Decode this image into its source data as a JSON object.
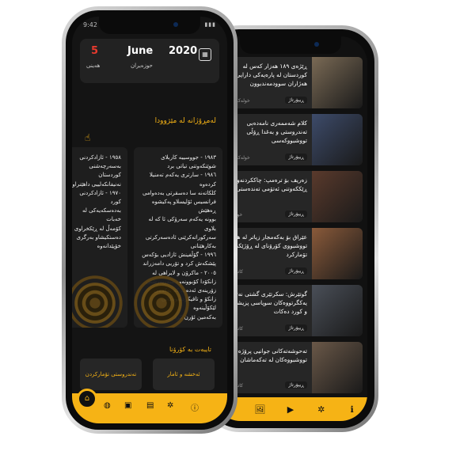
{
  "colors": {
    "accent": "#f6b315",
    "day_red": "#e83a2e",
    "background": "#141414",
    "card": "#222222"
  },
  "back_phone": {
    "news": [
      {
        "title": "ڕێژەی ١٨٩ هەزار کەس لە کوردستان لە پارەیەکی دارایی هەژاران سوودمەندبوون",
        "category": "ڕیپۆرتاژ",
        "meta": "16 خولەک لە",
        "thumb": "#7a6a55"
      },
      {
        "title": "کلام شەممەری نامەدەبی تەندروستی و بەغدا ڕۆڵی تووشبووکەسی",
        "category": "ڕیپۆرتاژ",
        "meta": "34 خولەک لە",
        "thumb": "#3d4b6a"
      },
      {
        "title": "زەریف بۆ ترەمپ: چاککردنەوەی ڕێککەوتنی ئەتۆمی تەندەستی",
        "category": "ڕیپۆرتاژ",
        "meta": "خولەک لە",
        "thumb": "#5a3a2c"
      },
      {
        "title": "عێراق بۆ بەکەمجار زیاتر لە هەزار تووشبووی کۆرۆنای لە ڕۆژێکدا تۆمارکرد",
        "category": "ڕیپۆرتاژ",
        "meta": "کاتژمێر لە",
        "thumb": "#8a5a3a"
      },
      {
        "title": "گوتێرش: سکرتێری گشتی نەتەوە یەکگرتووەکان سوپاسی پزیشکان و کورد دەکات",
        "category": "ڕیپۆرتاژ",
        "meta": "کاتژمێر لە",
        "thumb": "#4a4f58"
      },
      {
        "title": "تەحوشەتەکانی جوانیی پرۆژەی تووشبووەکان لە تەکەماشان",
        "category": "ڕیپۆرتاژ",
        "meta": "کاتژمێر لە",
        "thumb": "#6a5848"
      }
    ],
    "nav": [
      {
        "icon": "📍",
        "name": "location-icon"
      },
      {
        "icon": "🖼",
        "name": "image-icon"
      },
      {
        "icon": "▶",
        "name": "video-icon"
      },
      {
        "icon": "✲",
        "name": "star-icon"
      },
      {
        "icon": "ℹ",
        "name": "info-icon"
      }
    ]
  },
  "front_phone": {
    "status_time": "9:42",
    "date": {
      "day": "5",
      "day_name": "هەینی",
      "month": "June",
      "month_ku": "حوزەیران",
      "year": "2020"
    },
    "history_title": "لەمڕۆژانە لە مێژوودا",
    "history_cards": [
      {
        "text": "١٩٨٣ - جووسییە کاربلای\nشوێنکەوتنی تیاتی برد\n١٩٨٦ - سارتری یەکەم تەمنیلا کردەوە\nکلکاتەنه سا دەسقرتی بەدەوامی\nفرانسیس ئۆلیسلاو پەکیشوە ڕەهێش\nبوونە یەکەم سەرۆکی ئا کە لە بلاوی\nسەرکوراتەکرێنی ئادەسەرکرتی بەکارهێنانی\n١٩٩٦ - گۆڵفینش ئازادیی بۆکەس\nپێشکەش کرد و تۆریی دامەزراند\n٢٠٠٥ - ماکرۆن و لایراهی لە\nزانکۆدا کۆبوونەوە سەرپەرشتی\nزۆرینەی ئەدەب کە یەکەمی\nزانکۆ و تاقیکردنەوەکانی لێکۆڵینەوە\nبەکەمین ئۆرن کرد"
      },
      {
        "text": "١٩٥٨ - ئازادکردنی\nبەسەرچەشنی کوردستان\nنەنیفانکەلییی داهێنراو\n١٩٧٠ - ئازادکردنی کورد\nبەدەسکەیەکی لە خەبات\nکۆمەڵ لە ڕێکخراوی\nدەستکیشاو بەرگری\nخۆپێدانەوە"
      }
    ],
    "categories_title": "تایبەت بە کۆرۆنا",
    "categories": [
      "تەندروستی تۆمارکردن",
      "ئەخشە و ئامار"
    ],
    "nav": [
      {
        "icon": "⌂",
        "name": "home-icon"
      },
      {
        "icon": "◍",
        "name": "globe-icon"
      },
      {
        "icon": "▣",
        "name": "gallery-icon"
      },
      {
        "icon": "▤",
        "name": "video-icon"
      },
      {
        "icon": "✲",
        "name": "star-icon"
      },
      {
        "icon": "ⓘ",
        "name": "info-icon"
      }
    ]
  }
}
